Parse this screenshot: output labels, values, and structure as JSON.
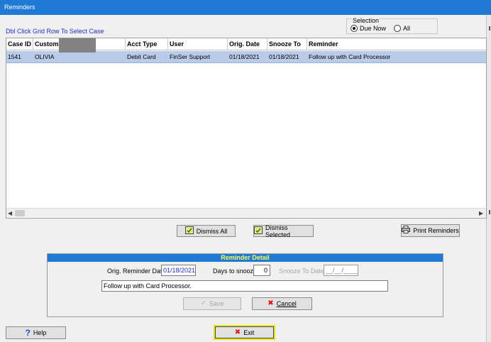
{
  "window": {
    "title": "Reminders"
  },
  "hint": "Dbl Click Grid Row To Select Case",
  "selection": {
    "title": "Selection",
    "options": [
      {
        "label": "Due Now",
        "selected": true
      },
      {
        "label": "All",
        "selected": false
      }
    ]
  },
  "grid": {
    "columns": [
      "Case ID",
      "Customer",
      "Acct Type",
      "User",
      "Orig. Date",
      "Snooze To",
      "Reminder"
    ],
    "rows": [
      {
        "case_id": "1541",
        "customer": "OLIVIA",
        "acct_type": "Debit Card",
        "user": "FinSer Support",
        "orig_date": "01/18/2021",
        "snooze_to": "01/18/2021",
        "reminder": "Follow up with Card Processor"
      }
    ]
  },
  "actions": {
    "dismiss_all": "Dismiss All",
    "dismiss_selected": "Dismiss Selected",
    "print_reminders": "Print Reminders"
  },
  "detail": {
    "header": "Reminder Detail",
    "orig_date_label": "Orig. Reminder Date",
    "orig_date_value": "01/18/2021",
    "days_label": "Days to snooze",
    "days_value": "0",
    "snooze_to_label": "Snooze To Date",
    "snooze_to_value": "__/__/____",
    "note": "Follow up with Card Processor.",
    "save_label": "Save",
    "cancel_label": "Cancel"
  },
  "footer": {
    "help_label": "Help",
    "exit_label": "Exit"
  },
  "colors": {
    "titlebar": "#1f7ad6",
    "selected_row": "#b8cbe8",
    "detail_header_text": "#ffff5a",
    "hint_text": "#1f2fc8",
    "exit_focus_border": "#e6e600"
  }
}
